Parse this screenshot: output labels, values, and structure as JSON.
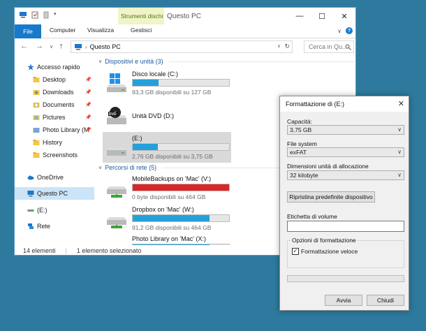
{
  "window": {
    "title": "Questo PC",
    "context_tab": "Strumenti dischi",
    "controls": {
      "minimize": "—",
      "maximize": "☐",
      "close": "✕"
    }
  },
  "ribbon": {
    "tabs": [
      "File",
      "Computer",
      "Visualizza",
      "Gestisci"
    ]
  },
  "address": {
    "back": "←",
    "forward": "→",
    "recent": "∨",
    "up": "↑",
    "path": "Questo PC",
    "search_placeholder": "Cerca in Qu..."
  },
  "nav": {
    "items": [
      {
        "label": "Accesso rapido",
        "icon": "star-icon"
      },
      {
        "label": "Desktop",
        "icon": "folder-icon",
        "pinned": true
      },
      {
        "label": "Downloads",
        "icon": "download-folder-icon",
        "pinned": true
      },
      {
        "label": "Documents",
        "icon": "documents-folder-icon",
        "pinned": true
      },
      {
        "label": "Pictures",
        "icon": "pictures-folder-icon",
        "pinned": true
      },
      {
        "label": "Photo Library (M",
        "icon": "folder-icon",
        "pinned": true
      },
      {
        "label": "History",
        "icon": "folder-icon"
      },
      {
        "label": "Screenshots",
        "icon": "folder-icon"
      },
      {
        "label": "OneDrive",
        "icon": "cloud-icon"
      },
      {
        "label": "Questo PC",
        "icon": "computer-icon",
        "selected": true
      },
      {
        "label": "(E:)",
        "icon": "usb-drive-icon"
      },
      {
        "label": "Rete",
        "icon": "network-icon"
      }
    ]
  },
  "groups": {
    "devices": "Dispositivi e unità (3)",
    "network": "Percorsi di rete (5)"
  },
  "drives": [
    {
      "name": "Disco locale (C:)",
      "info": "93,3 GB disponibili su 127 GB",
      "used": 0.27,
      "icon": "windows-drive-icon"
    },
    {
      "name": "Unità DVD (D:)",
      "info": "",
      "used": null,
      "icon": "dvd-drive-icon"
    },
    {
      "name": "(E:)",
      "info": "2,76 GB disponibili su 3,75 GB",
      "used": 0.26,
      "icon": "usb-drive-icon",
      "selected": true
    },
    {
      "name": "MobileBackups on 'Mac' (V:)",
      "info": "0 byte disponibili su 464 GB",
      "used": 1.0,
      "icon": "network-drive-icon",
      "full": true
    },
    {
      "name": "Dropbox on 'Mac' (W:)",
      "info": "91,2 GB disponibili su 464 GB",
      "used": 0.8,
      "icon": "network-drive-icon"
    },
    {
      "name": "Photo Library on 'Mac' (X:)",
      "info": "",
      "used": 0.8,
      "icon": "network-drive-icon"
    }
  ],
  "status": {
    "count": "14 elementi",
    "selection": "1 elemento selezionato"
  },
  "dialog": {
    "title": "Formattazione di  (E:)",
    "capacity_label": "Capacità:",
    "capacity_value": "3,75 GB",
    "fs_label": "File system",
    "fs_value": "exFAT",
    "alloc_label": "Dimensioni unità di allocazione",
    "alloc_value": "32 kilobyte",
    "restore_button": "Ripristina predefinite dispositivo",
    "volume_label": "Etichetta di volume",
    "volume_value": "",
    "options_legend": "Opzioni di formattazione",
    "quick_format_label": "Formattazione veloce",
    "quick_format_checked": "✓",
    "progress": 0,
    "start_button": "Avvia",
    "close_button": "Chiudi"
  },
  "colors": {
    "desktop": "#2d7a9e",
    "accent": "#1979ca",
    "bar_fill": "#26a0da",
    "bar_full": "#da2626",
    "context_tab": "#f1f3c9"
  }
}
